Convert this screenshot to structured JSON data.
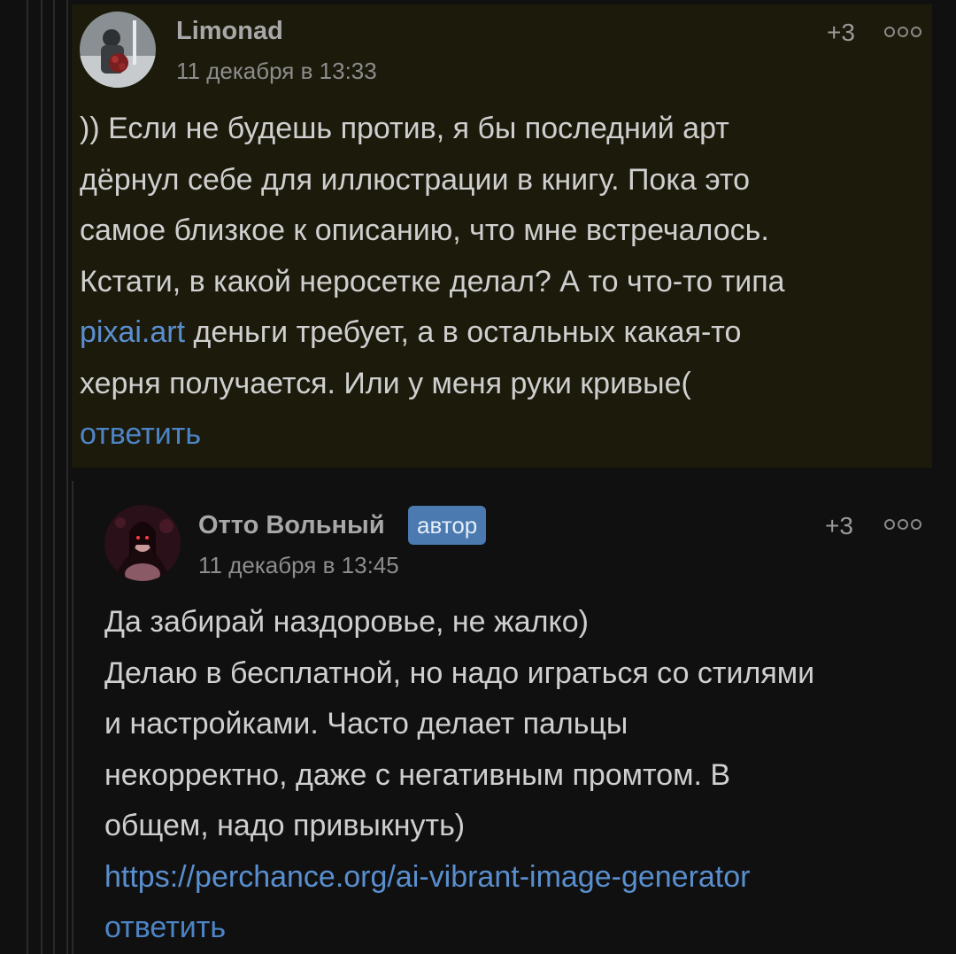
{
  "comments": [
    {
      "username": "Limonad",
      "date": "11 декабря в 13:33",
      "rating": "+3",
      "text_before_link": ")) Если не будешь против, я бы последний арт\nдёрнул себе для иллюстрации в книгу. Пока это\nсамое близкое к описанию, что мне встречалось.\nКстати, в какой неросетке делал? А то что-то типа\n",
      "link": "pixai.art",
      "text_after_link": " деньги требует, а в остальных какая-то\nхерня получается. Или у меня руки кривые(",
      "reply_label": "ответить",
      "more_icon": "ellipsis-icon"
    },
    {
      "username": "Отто Вольный",
      "badge": "автор",
      "date": "11 декабря в 13:45",
      "rating": "+3",
      "text_before_link": "Да забирай наздоровье, не жалко)\nДелаю в бесплатной, но надо играться со стилями\nи настройками. Часто делает пальцы\nнекорректно, даже с негативным промтом. В\nобщем, надо привыкнуть)\n",
      "link": "https://perchance.org/ai-vibrant-image-generator",
      "text_after_link": "",
      "reply_label": "ответить",
      "more_icon": "ellipsis-icon"
    }
  ],
  "colors": {
    "background": "#101010",
    "highlight_background": "#1c1a0b",
    "link": "#5a8fcf",
    "badge": "#4a7ab0"
  }
}
